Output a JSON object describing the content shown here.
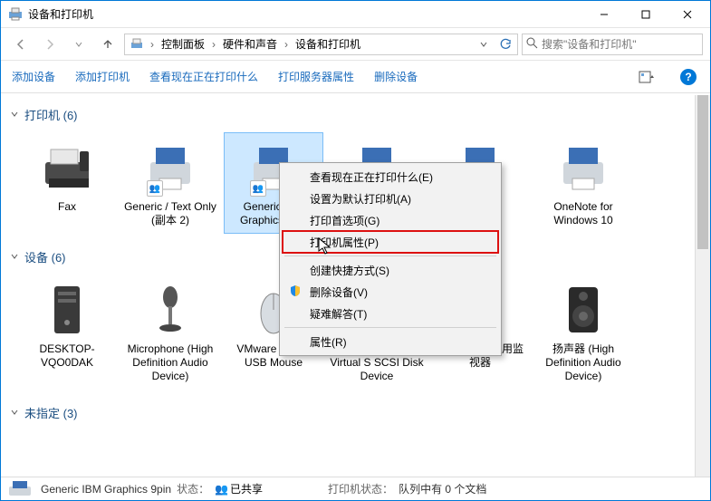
{
  "window": {
    "title": "设备和打印机",
    "minimize": "–",
    "maximize": "□",
    "close": "×"
  },
  "nav": {
    "breadcrumb_icon": "pc",
    "segments": [
      "控制面板",
      "硬件和声音",
      "设备和打印机"
    ],
    "search_placeholder": "搜索\"设备和打印机\""
  },
  "commands": {
    "add_device": "添加设备",
    "add_printer": "添加打印机",
    "see_printing": "查看现在正在打印什么",
    "server_props": "打印服务器属性",
    "remove_device": "删除设备"
  },
  "groups": {
    "printers": {
      "label": "打印机 (6)"
    },
    "devices": {
      "label": "设备 (6)"
    },
    "unspecified": {
      "label": "未指定 (3)"
    }
  },
  "printers": [
    {
      "name": "Fax",
      "icon": "fax"
    },
    {
      "name": "Generic / Text Only (副本 2)",
      "icon": "printer",
      "shared": true
    },
    {
      "name": "Generic IBM Graphics 9pin",
      "icon": "printer",
      "shared": true,
      "selected": true
    },
    {
      "name": "",
      "icon": "printer"
    },
    {
      "name": "",
      "icon": "printer"
    },
    {
      "name": "OneNote for Windows 10",
      "icon": "printer"
    }
  ],
  "devices": [
    {
      "name": "DESKTOP-VQO0DAK",
      "icon": "pc-tower"
    },
    {
      "name": "Microphone (High Definition Audio Device)",
      "icon": "mic"
    },
    {
      "name": "VMware Virtual USB Mouse",
      "icon": "mouse"
    },
    {
      "name": "VMware, VMware Virtual S SCSI Disk Device",
      "icon": "hdd"
    },
    {
      "name": "通用非即插即用监视器",
      "icon": "monitor"
    },
    {
      "name": "扬声器 (High Definition Audio Device)",
      "icon": "speaker"
    }
  ],
  "context_menu": {
    "see_whats_printing": "查看现在正在打印什么(E)",
    "set_default": "设置为默认打印机(A)",
    "printing_prefs": "打印首选项(G)",
    "printer_props": "打印机属性(P)",
    "create_shortcut": "创建快捷方式(S)",
    "remove_device": "删除设备(V)",
    "troubleshoot": "疑难解答(T)",
    "properties": "属性(R)"
  },
  "status": {
    "name": "Generic IBM Graphics 9pin",
    "state_label": "状态：",
    "state_value": "已共享",
    "queue_label": "打印机状态：",
    "queue_value": "队列中有 0 个文档"
  }
}
